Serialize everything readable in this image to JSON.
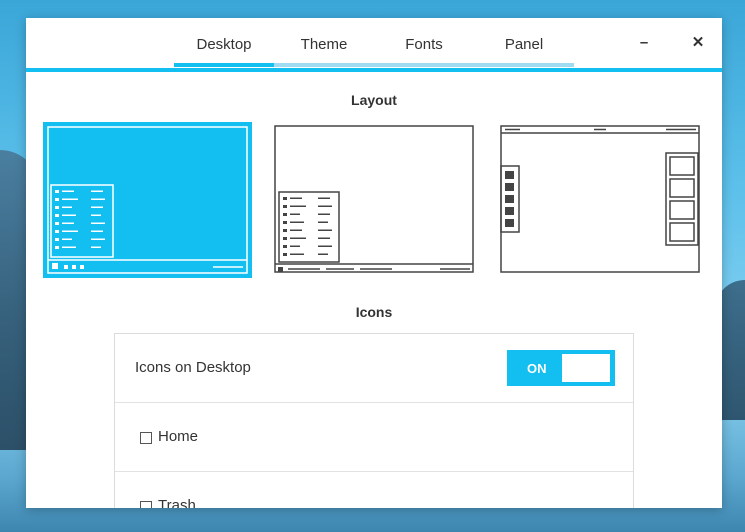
{
  "tabs": [
    {
      "label": "Desktop",
      "active": true
    },
    {
      "label": "Theme",
      "active": false
    },
    {
      "label": "Fonts",
      "active": false
    },
    {
      "label": "Panel",
      "active": false
    }
  ],
  "window_controls": {
    "minimize": "–",
    "close": "✕"
  },
  "layout": {
    "title": "Layout",
    "options": [
      {
        "name": "bottom-panel-layout",
        "selected": true
      },
      {
        "name": "bottom-panel-outline-layout",
        "selected": false
      },
      {
        "name": "top-panel-side-docks-layout",
        "selected": false
      }
    ]
  },
  "icons": {
    "title": "Icons",
    "desktop_icons_label": "Icons on Desktop",
    "toggle_label": "ON",
    "toggle_on": true,
    "items": [
      {
        "label": "Home",
        "checked": false
      },
      {
        "label": "Trash",
        "checked": false
      }
    ]
  },
  "colors": {
    "accent": "#12bff0"
  }
}
